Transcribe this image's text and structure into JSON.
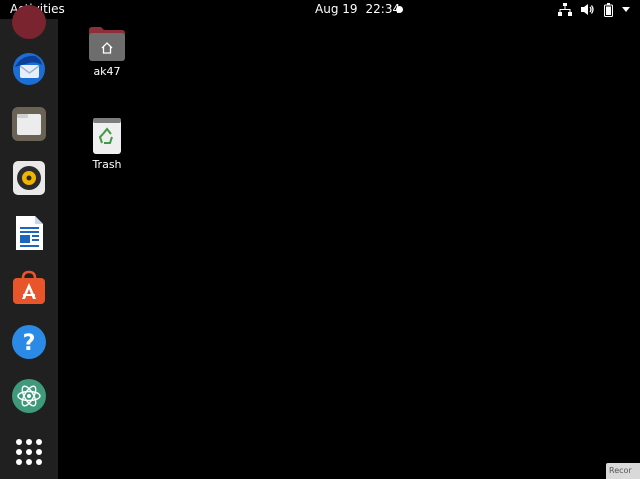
{
  "topbar": {
    "activities_label": "Activities",
    "date": "Aug 19",
    "time": "22:34"
  },
  "status_icons": [
    "network-icon",
    "volume-icon",
    "battery-icon"
  ],
  "dock": {
    "items": [
      {
        "name": "app-icon-partial"
      },
      {
        "name": "thunderbird-icon"
      },
      {
        "name": "files-icon"
      },
      {
        "name": "rhythmbox-icon"
      },
      {
        "name": "libreoffice-writer-icon"
      },
      {
        "name": "ubuntu-software-icon"
      },
      {
        "name": "help-icon"
      },
      {
        "name": "atom-icon"
      },
      {
        "name": "show-applications-icon"
      }
    ]
  },
  "desktop": {
    "home_label": "ak47",
    "trash_label": "Trash"
  },
  "recorder_tag": "Recor",
  "colors": {
    "background": "#000000",
    "dock": "#202020",
    "software_orange": "#e9552b",
    "help_blue": "#2a8ae6",
    "atom_green": "#3e9a7a"
  }
}
